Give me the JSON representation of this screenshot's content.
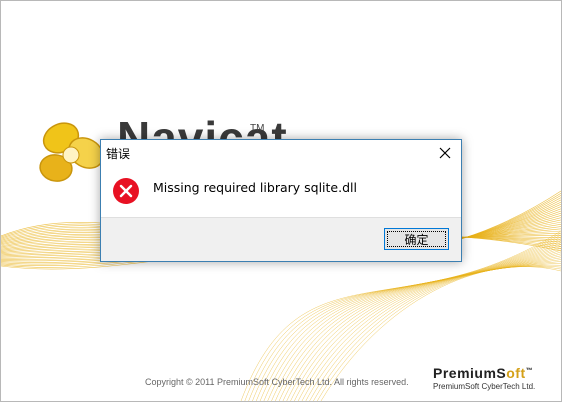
{
  "splash": {
    "product_name": "Navicat",
    "product_tm": "TM",
    "copyright": "Copyright © 2011 PremiumSoft CyberTech Ltd. All rights reserved.",
    "vendor": {
      "premium": "PremiumS",
      "soft": "oft",
      "tm": "™",
      "sub": "PremiumSoft CyberTech Ltd."
    },
    "colors": {
      "wave": "#e8b21a",
      "logo": "#f0c419"
    }
  },
  "dialog": {
    "title": "错误",
    "message": "Missing required library sqlite.dll",
    "ok_label": "确定",
    "icons": {
      "error": "error-x-icon",
      "close": "close-icon"
    },
    "colors": {
      "border": "#3c7fb1",
      "error": "#e81123"
    }
  }
}
